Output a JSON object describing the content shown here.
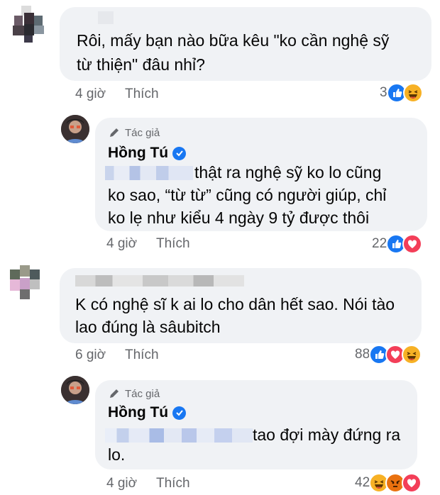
{
  "comments": [
    {
      "text_lines": [
        "Rôi, mấy bạn nào bữa kêu \"ko cần nghệ sỹ",
        "từ thiện\" đâu nhỉ?"
      ],
      "time": "4 giờ",
      "like_label": "Thích",
      "reaction_count": "3",
      "reactions": [
        "like-icon",
        "haha-icon"
      ],
      "reply": {
        "author_tag": "Tác giả",
        "author_name": "Hồng Tú",
        "text_lines": [
          "thật ra nghệ sỹ ko lo cũng",
          "ko sao, “từ từ” cũng có người giúp, chỉ",
          "ko lẹ như kiểu 4 ngày 9 tỷ được thôi"
        ],
        "time": "4 giờ",
        "like_label": "Thích",
        "reaction_count": "22",
        "reactions": [
          "like-icon",
          "love-icon"
        ]
      }
    },
    {
      "text_lines": [
        "K có nghệ sĩ k ai lo cho dân hết sao. Nói tào",
        "lao đúng là sâubitch"
      ],
      "time": "6 giờ",
      "like_label": "Thích",
      "reaction_count": "88",
      "reactions": [
        "like-icon",
        "love-icon",
        "haha-icon"
      ],
      "reply": {
        "author_tag": "Tác giả",
        "author_name": "Hồng Tú",
        "text_lines": [
          "tao đợi mày đứng ra",
          "lo."
        ],
        "time": "4 giờ",
        "like_label": "Thích",
        "reaction_count": "42",
        "reactions": [
          "haha-icon",
          "angry-icon",
          "love-icon"
        ]
      }
    }
  ],
  "colors": {
    "bubble": "#f0f2f5",
    "meta_text": "#65676b",
    "like_blue": "#1877f2",
    "love_red": "#f33e58",
    "haha_yellow": "#f7b125",
    "angry_orange": "#e9710f"
  }
}
